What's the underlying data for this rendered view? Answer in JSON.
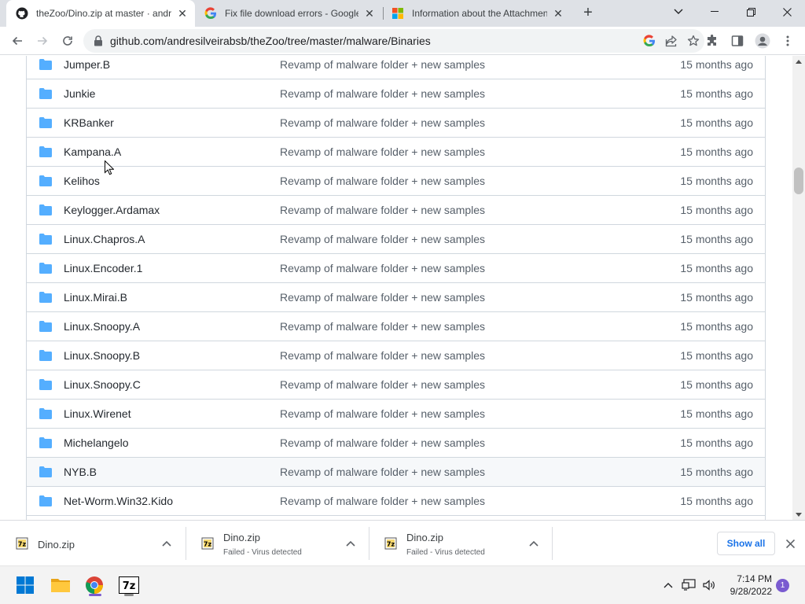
{
  "tabs": [
    {
      "title": "theZoo/Dino.zip at master · andresilveirabsb/theZoo",
      "active": true,
      "favicon": "github-icon"
    },
    {
      "title": "Fix file download errors - Google Chrome Help",
      "active": false,
      "favicon": "google-icon"
    },
    {
      "title": "Information about the Attachment Manager in Microsoft Windows",
      "active": false,
      "favicon": "microsoft-icon"
    }
  ],
  "address_bar": {
    "url": "github.com/andresilveirabsb/theZoo/tree/master/malware/Binaries"
  },
  "files": [
    {
      "name": "Jumper.B",
      "message": "Revamp of malware folder + new samples",
      "age": "15 months ago"
    },
    {
      "name": "Junkie",
      "message": "Revamp of malware folder + new samples",
      "age": "15 months ago"
    },
    {
      "name": "KRBanker",
      "message": "Revamp of malware folder + new samples",
      "age": "15 months ago"
    },
    {
      "name": "Kampana.A",
      "message": "Revamp of malware folder + new samples",
      "age": "15 months ago"
    },
    {
      "name": "Kelihos",
      "message": "Revamp of malware folder + new samples",
      "age": "15 months ago"
    },
    {
      "name": "Keylogger.Ardamax",
      "message": "Revamp of malware folder + new samples",
      "age": "15 months ago"
    },
    {
      "name": "Linux.Chapros.A",
      "message": "Revamp of malware folder + new samples",
      "age": "15 months ago"
    },
    {
      "name": "Linux.Encoder.1",
      "message": "Revamp of malware folder + new samples",
      "age": "15 months ago"
    },
    {
      "name": "Linux.Mirai.B",
      "message": "Revamp of malware folder + new samples",
      "age": "15 months ago"
    },
    {
      "name": "Linux.Snoopy.A",
      "message": "Revamp of malware folder + new samples",
      "age": "15 months ago"
    },
    {
      "name": "Linux.Snoopy.B",
      "message": "Revamp of malware folder + new samples",
      "age": "15 months ago"
    },
    {
      "name": "Linux.Snoopy.C",
      "message": "Revamp of malware folder + new samples",
      "age": "15 months ago"
    },
    {
      "name": "Linux.Wirenet",
      "message": "Revamp of malware folder + new samples",
      "age": "15 months ago"
    },
    {
      "name": "Michelangelo",
      "message": "Revamp of malware folder + new samples",
      "age": "15 months ago"
    },
    {
      "name": "NYB.B",
      "message": "Revamp of malware folder + new samples",
      "age": "15 months ago"
    },
    {
      "name": "Net-Worm.Win32.Kido",
      "message": "Revamp of malware folder + new samples",
      "age": "15 months ago"
    }
  ],
  "downloads": [
    {
      "name": "Dino.zip",
      "status": ""
    },
    {
      "name": "Dino.zip",
      "status": "Failed - Virus detected"
    },
    {
      "name": "Dino.zip",
      "status": "Failed - Virus detected"
    }
  ],
  "download_shelf": {
    "show_all_label": "Show all"
  },
  "taskbar": {
    "time": "7:14 PM",
    "date": "9/28/2022",
    "notification_count": "1"
  },
  "colors": {
    "folder": "#54aeff",
    "link_blue": "#1a73e8",
    "accent_purple": "#7a5bd0"
  }
}
